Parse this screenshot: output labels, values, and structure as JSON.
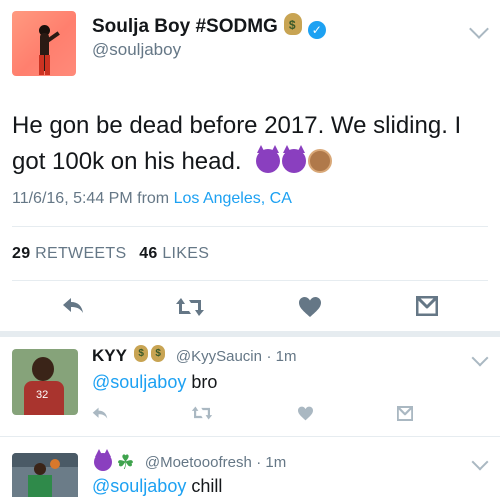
{
  "main_tweet": {
    "display_name": "Soulja Boy #SODMG",
    "handle": "@souljaboy",
    "text_line1": "He gon be dead before 2017. We sliding. I",
    "text_line2": "got 100k on his head.",
    "timestamp": "11/6/16, 5:44 PM from",
    "location": "Los Angeles, CA",
    "retweets_count": "29",
    "retweets_label": "RETWEETS",
    "likes_count": "46",
    "likes_label": "LIKES"
  },
  "replies": [
    {
      "display_name": "KYY",
      "handle": "@KyySaucin",
      "time": "· 1m",
      "mention": "@souljaboy",
      "text": "bro"
    },
    {
      "display_name": "",
      "handle": "@Moetooofresh",
      "time": "· 1m",
      "mention": "@souljaboy",
      "text": "chill"
    }
  ],
  "colors": {
    "accent": "#1da1f2",
    "muted": "#657786",
    "icon": "#8899a6",
    "divider": "#e6ecf0"
  },
  "icons": [
    "money-bag-icon",
    "verified-icon",
    "chevron-down-icon",
    "reply-icon",
    "retweet-icon",
    "heart-icon",
    "dm-icon",
    "devil-emoji-icon",
    "see-no-evil-monkey-icon",
    "shamrock-icon"
  ]
}
